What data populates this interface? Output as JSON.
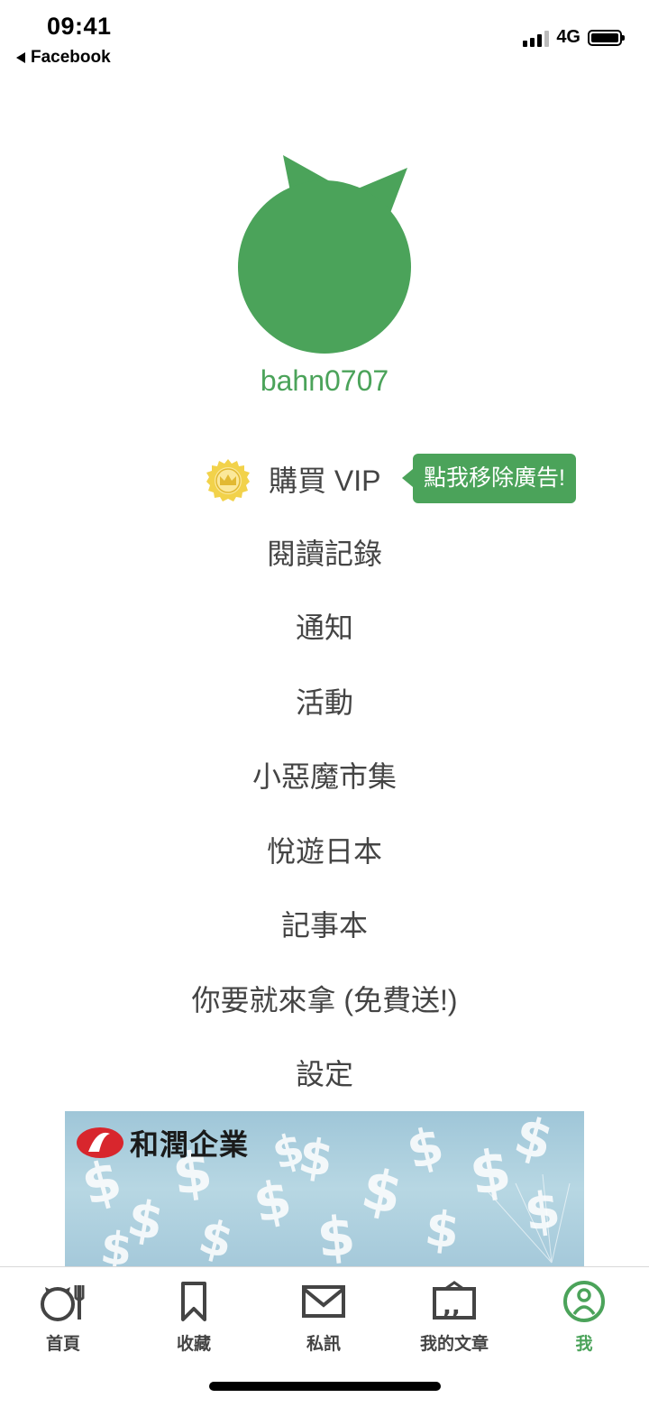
{
  "status_bar": {
    "time": "09:41",
    "back_app": "Facebook",
    "network": "4G"
  },
  "profile": {
    "username": "bahn0707",
    "avatar_color": "#4ba35a"
  },
  "vip": {
    "label": "購買 VIP",
    "tooltip": "點我移除廣告!"
  },
  "menu": {
    "items": [
      {
        "label": "閱讀記錄"
      },
      {
        "label": "通知"
      },
      {
        "label": "活動"
      },
      {
        "label": "小惡魔市集"
      },
      {
        "label": "悅遊日本"
      },
      {
        "label": "記事本"
      },
      {
        "label": "你要就來拿 (免費送!)"
      },
      {
        "label": "設定"
      }
    ]
  },
  "banner": {
    "brand_text": "和潤企業"
  },
  "tabbar": {
    "tabs": [
      {
        "label": "首頁",
        "icon": "home-icon"
      },
      {
        "label": "收藏",
        "icon": "bookmark-icon"
      },
      {
        "label": "私訊",
        "icon": "mail-icon"
      },
      {
        "label": "我的文章",
        "icon": "article-icon"
      },
      {
        "label": "我",
        "icon": "profile-icon",
        "active": true
      }
    ]
  },
  "colors": {
    "accent": "#4ba35a",
    "vip_gold": "#f2d24b"
  }
}
